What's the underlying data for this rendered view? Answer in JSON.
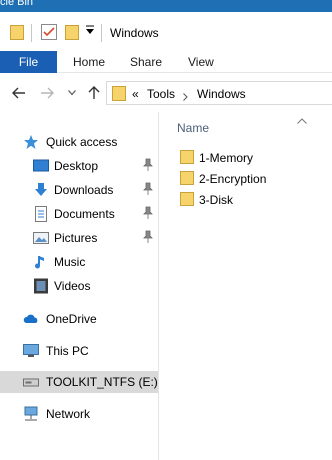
{
  "desktop": {
    "partial_label": "cle Bin"
  },
  "window": {
    "title": "Windows"
  },
  "ribbon": {
    "tabs": [
      "File",
      "Home",
      "Share",
      "View"
    ]
  },
  "address": {
    "overflow": "«",
    "crumbs": [
      "Tools",
      "Windows"
    ]
  },
  "nav": {
    "quick_access": "Quick access",
    "pinned": [
      {
        "label": "Desktop",
        "icon": "desktop-icon",
        "pinned": true
      },
      {
        "label": "Downloads",
        "icon": "downloads-icon",
        "pinned": true
      },
      {
        "label": "Documents",
        "icon": "documents-icon",
        "pinned": true
      },
      {
        "label": "Pictures",
        "icon": "pictures-icon",
        "pinned": true
      },
      {
        "label": "Music",
        "icon": "music-icon",
        "pinned": false
      },
      {
        "label": "Videos",
        "icon": "videos-icon",
        "pinned": false
      }
    ],
    "onedrive": "OneDrive",
    "this_pc": "This PC",
    "drive": "TOOLKIT_NTFS (E:)",
    "network": "Network"
  },
  "content": {
    "column_header": "Name",
    "items": [
      "1-Memory",
      "2-Encryption",
      "3-Disk"
    ]
  },
  "colors": {
    "accent": "#1a5fb4",
    "folder": "#f7d46b",
    "selection": "#d9d9d9"
  }
}
